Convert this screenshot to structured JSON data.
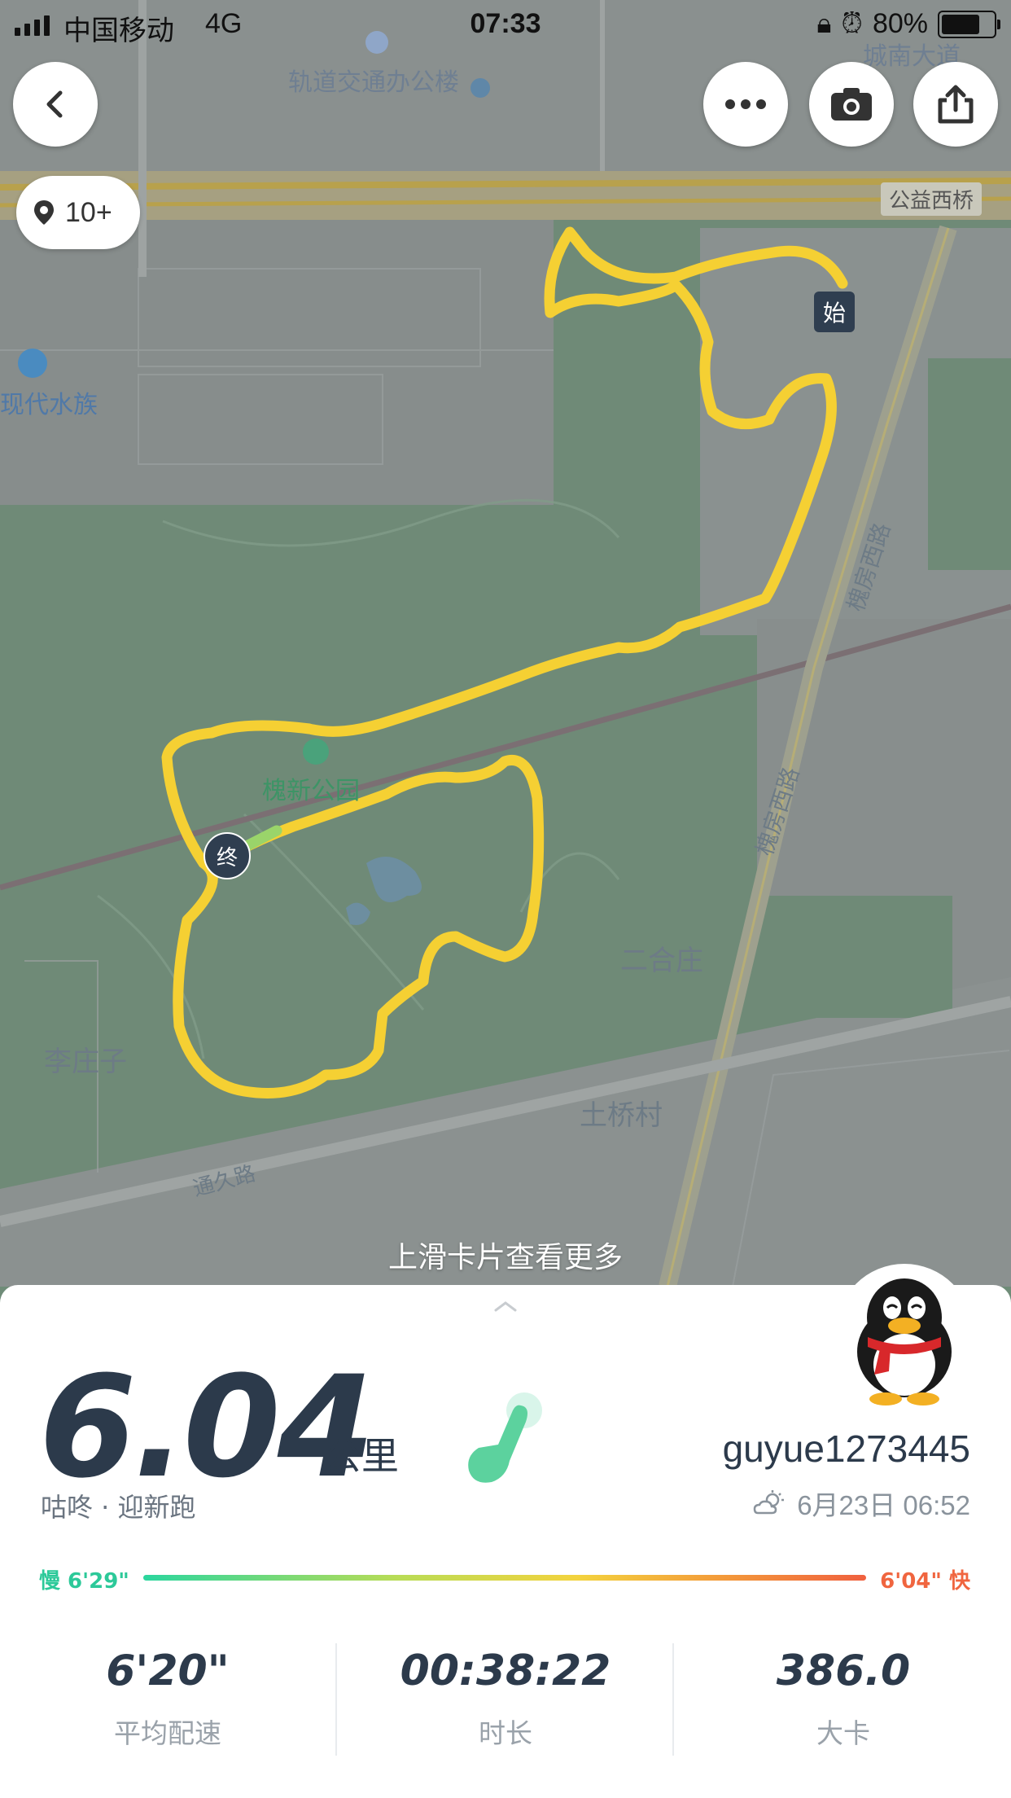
{
  "status_bar": {
    "carrier": "中国移动",
    "network": "4G",
    "time": "07:33",
    "battery": "80%",
    "battery_level": 0.8
  },
  "map": {
    "poi_count": "10+",
    "labels": {
      "office": "轨道交通办公楼",
      "road_top_right": "城南大道",
      "bridge": "公益西桥",
      "aquarium": "现代水族",
      "park": "槐新公园",
      "road_huaifang1": "槐房西路",
      "road_huaifang2": "槐房西路",
      "erhezhuang": "二合庄",
      "lizhuangzi": "李庄子",
      "tuqiaocun": "土桥村",
      "tongjiu_road": "通久路"
    },
    "start_marker": "始",
    "end_marker": "终"
  },
  "swipe_hint": "上滑卡片查看更多",
  "summary": {
    "distance": "6.04",
    "distance_unit": "公里",
    "subtitle": "咕咚 · 迎新跑",
    "username": "guyue1273445",
    "datetime": "6月23日 06:52"
  },
  "pace_range": {
    "slow_label": "慢 6'29\"",
    "fast_label": "6'04\" 快"
  },
  "stats": [
    {
      "value": "6'20\"",
      "label": "平均配速"
    },
    {
      "value": "00:38:22",
      "label": "时长"
    },
    {
      "value": "386.0",
      "label": "大卡"
    }
  ],
  "colors": {
    "route": "#f5d033",
    "accent_green": "#2cc999",
    "accent_red": "#f0653f",
    "text_dark": "#2c3a4b"
  },
  "icons": [
    "back-icon",
    "more-icon",
    "camera-icon",
    "share-icon",
    "location-pin-icon",
    "weather-icon",
    "chevron-up-icon",
    "hand-tap-icon",
    "qq-penguin-avatar"
  ]
}
